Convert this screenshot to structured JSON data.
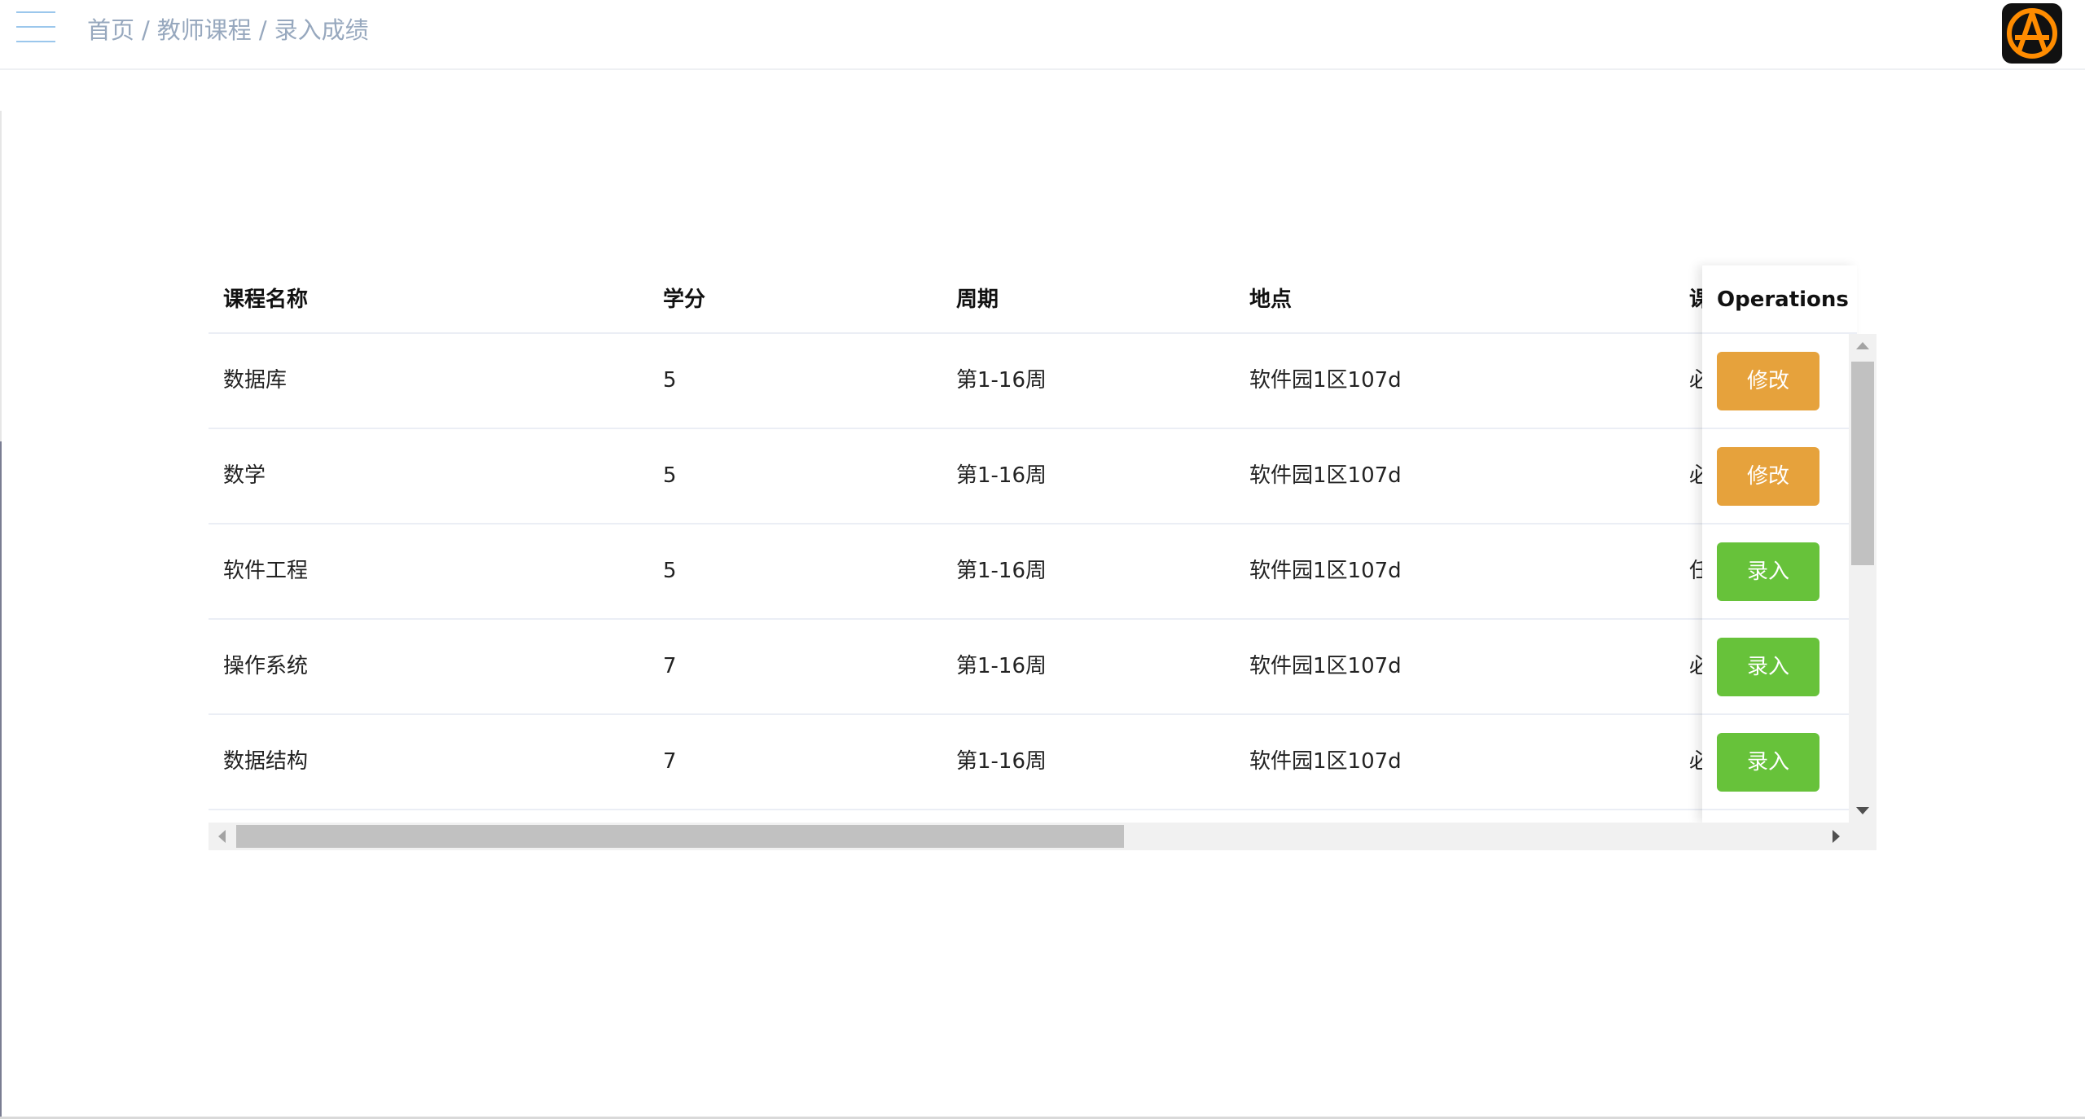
{
  "header": {
    "menu_icon": "hamburger-menu-icon",
    "breadcrumb": [
      "首页",
      "教师课程",
      "录入成绩"
    ],
    "breadcrumb_separator": "/",
    "avatar_icon": "anarchy-a-logo-icon",
    "avatar_colors": {
      "background": "#111111",
      "ring": "#ff8c00"
    }
  },
  "table": {
    "headers": {
      "name": "课程名称",
      "credit": "学分",
      "period": "周期",
      "place": "地点",
      "type_clipped": "课",
      "operations": "Operations"
    },
    "rows": [
      {
        "name": "数据库",
        "credit": "5",
        "period": "第1-16周",
        "place": "软件园1区107d",
        "type_clipped": "必",
        "action": "修改",
        "action_kind": "edit"
      },
      {
        "name": "数学",
        "credit": "5",
        "period": "第1-16周",
        "place": "软件园1区107d",
        "type_clipped": "必",
        "action": "修改",
        "action_kind": "edit"
      },
      {
        "name": "软件工程",
        "credit": "5",
        "period": "第1-16周",
        "place": "软件园1区107d",
        "type_clipped": "任",
        "action": "录入",
        "action_kind": "enter"
      },
      {
        "name": "操作系统",
        "credit": "7",
        "period": "第1-16周",
        "place": "软件园1区107d",
        "type_clipped": "必",
        "action": "录入",
        "action_kind": "enter"
      },
      {
        "name": "数据结构",
        "credit": "7",
        "period": "第1-16周",
        "place": "软件园1区107d",
        "type_clipped": "必",
        "action": "录入",
        "action_kind": "enter"
      }
    ]
  },
  "colors": {
    "edit_button": "#e6a23c",
    "enter_button": "#67c23a",
    "breadcrumb_text": "#97a8be"
  }
}
